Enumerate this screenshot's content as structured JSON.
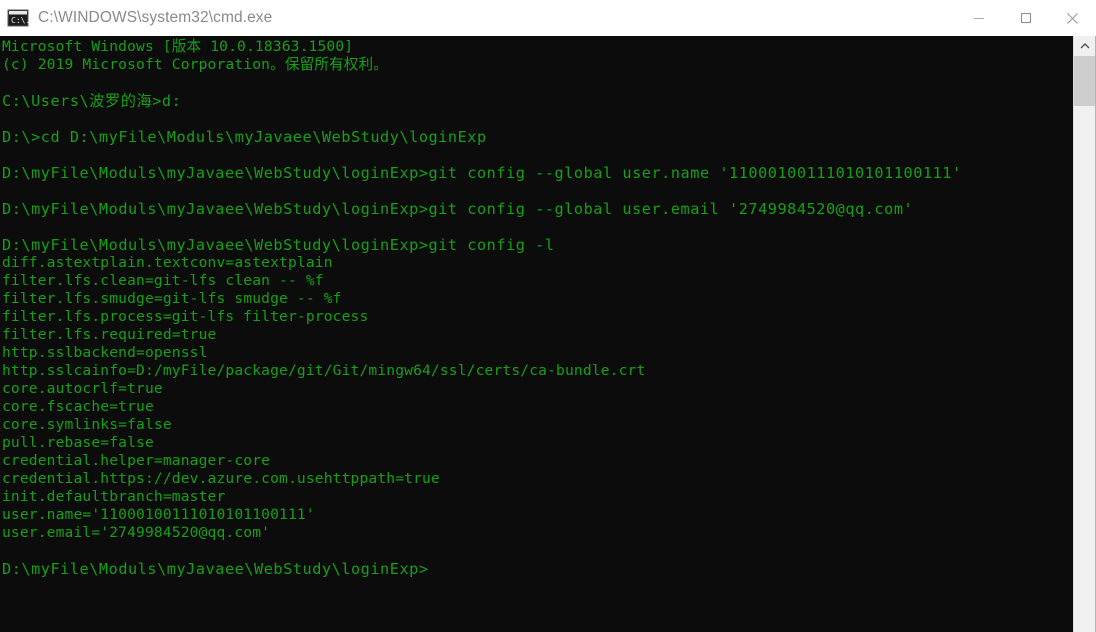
{
  "window": {
    "title": "C:\\WINDOWS\\system32\\cmd.exe",
    "icon": "cmd-console-icon",
    "background_color": "#0c0c0c",
    "text_color": "#16a016",
    "titlebar_color": "#ffffff",
    "controls": {
      "minimize_label": "Minimize",
      "maximize_label": "Maximize",
      "close_label": "Close"
    }
  },
  "scrollbar": {
    "up_arrow": "chevron-up-icon",
    "thumb_position": "top"
  },
  "terminal": {
    "lines": [
      {
        "id": 0,
        "kind": "out",
        "text": "Microsoft Windows [版本 10.0.18363.1500]"
      },
      {
        "id": 1,
        "kind": "out",
        "text": "(c) 2019 Microsoft Corporation。保留所有权利。"
      },
      {
        "id": 2,
        "kind": "blank",
        "text": " "
      },
      {
        "id": 3,
        "kind": "prompt",
        "text": "C:\\Users\\波罗的海>d:"
      },
      {
        "id": 4,
        "kind": "blank",
        "text": " "
      },
      {
        "id": 5,
        "kind": "prompt",
        "text": "D:\\>cd D:\\myFile\\Moduls\\myJavaee\\WebStudy\\loginExp"
      },
      {
        "id": 6,
        "kind": "blank",
        "text": " "
      },
      {
        "id": 7,
        "kind": "prompt",
        "text": "D:\\myFile\\Moduls\\myJavaee\\WebStudy\\loginExp>git config --global user.name '11000100111010101100111'"
      },
      {
        "id": 8,
        "kind": "blank",
        "text": " "
      },
      {
        "id": 9,
        "kind": "prompt",
        "text": "D:\\myFile\\Moduls\\myJavaee\\WebStudy\\loginExp>git config --global user.email '2749984520@qq.com'"
      },
      {
        "id": 10,
        "kind": "blank",
        "text": " "
      },
      {
        "id": 11,
        "kind": "prompt",
        "text": "D:\\myFile\\Moduls\\myJavaee\\WebStudy\\loginExp>git config -l"
      },
      {
        "id": 12,
        "kind": "out",
        "text": "diff.astextplain.textconv=astextplain"
      },
      {
        "id": 13,
        "kind": "out",
        "text": "filter.lfs.clean=git-lfs clean -- %f"
      },
      {
        "id": 14,
        "kind": "out",
        "text": "filter.lfs.smudge=git-lfs smudge -- %f"
      },
      {
        "id": 15,
        "kind": "out",
        "text": "filter.lfs.process=git-lfs filter-process"
      },
      {
        "id": 16,
        "kind": "out",
        "text": "filter.lfs.required=true"
      },
      {
        "id": 17,
        "kind": "out",
        "text": "http.sslbackend=openssl"
      },
      {
        "id": 18,
        "kind": "out",
        "text": "http.sslcainfo=D:/myFile/package/git/Git/mingw64/ssl/certs/ca-bundle.crt"
      },
      {
        "id": 19,
        "kind": "out",
        "text": "core.autocrlf=true"
      },
      {
        "id": 20,
        "kind": "out",
        "text": "core.fscache=true"
      },
      {
        "id": 21,
        "kind": "out",
        "text": "core.symlinks=false"
      },
      {
        "id": 22,
        "kind": "out",
        "text": "pull.rebase=false"
      },
      {
        "id": 23,
        "kind": "out",
        "text": "credential.helper=manager-core"
      },
      {
        "id": 24,
        "kind": "out",
        "text": "credential.https://dev.azure.com.usehttppath=true"
      },
      {
        "id": 25,
        "kind": "out",
        "text": "init.defaultbranch=master"
      },
      {
        "id": 26,
        "kind": "out",
        "text": "user.name='11000100111010101100111'"
      },
      {
        "id": 27,
        "kind": "out",
        "text": "user.email='2749984520@qq.com'"
      },
      {
        "id": 28,
        "kind": "blank",
        "text": " "
      },
      {
        "id": 29,
        "kind": "prompt",
        "text": "D:\\myFile\\Moduls\\myJavaee\\WebStudy\\loginExp>"
      }
    ]
  }
}
